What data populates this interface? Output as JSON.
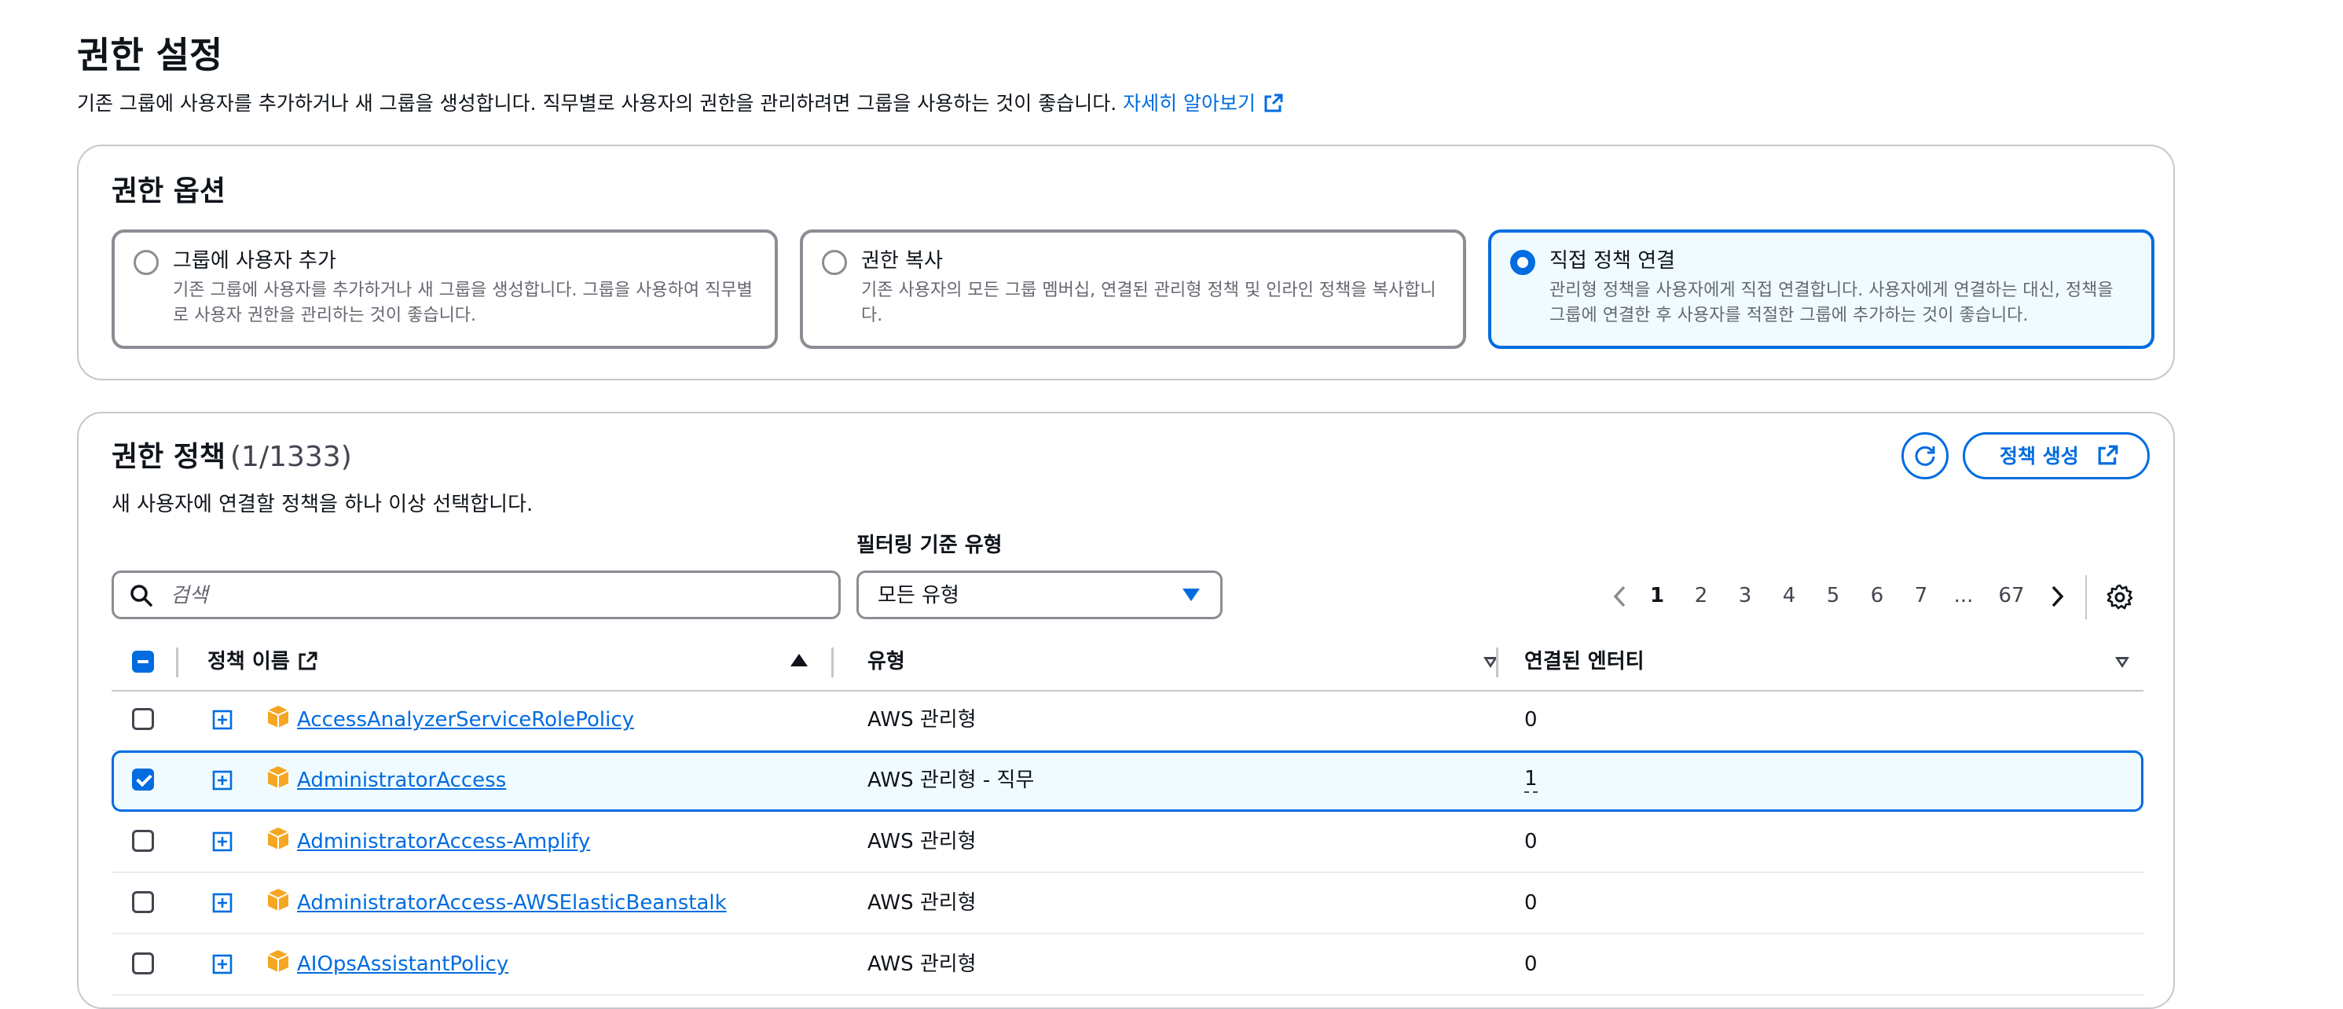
{
  "page": {
    "title": "권한 설정",
    "description": "기존 그룹에 사용자를 추가하거나 새 그룹을 생성합니다. 직무별로 사용자의 권한을 관리하려면 그룹을 사용하는 것이 좋습니다.",
    "learn_more": "자세히 알아보기"
  },
  "options": {
    "title": "권한 옵션",
    "tiles": [
      {
        "label": "그룹에 사용자 추가",
        "desc": "기존 그룹에 사용자를 추가하거나 새 그룹을 생성합니다. 그룹을 사용하여 직무별로 사용자 권한을 관리하는 것이 좋습니다.",
        "selected": false
      },
      {
        "label": "권한 복사",
        "desc": "기존 사용자의 모든 그룹 멤버십, 연결된 관리형 정책 및 인라인 정책을 복사합니다.",
        "selected": false
      },
      {
        "label": "직접 정책 연결",
        "desc": "관리형 정책을 사용자에게 직접 연결합니다. 사용자에게 연결하는 대신, 정책을 그룹에 연결한 후 사용자를 적절한 그룹에 추가하는 것이 좋습니다.",
        "selected": true
      }
    ]
  },
  "policies": {
    "title": "권한 정책",
    "count": "(1/1333)",
    "description": "새 사용자에 연결할 정책을 하나 이상 선택합니다.",
    "create_button": "정책 생성",
    "search": {
      "placeholder": "검색",
      "value": ""
    },
    "filter": {
      "label": "필터링 기준 유형",
      "value": "모든 유형"
    },
    "pagination": {
      "pages": [
        "1",
        "2",
        "3",
        "4",
        "5",
        "6",
        "7",
        "...",
        "67"
      ],
      "current": "1"
    },
    "columns": {
      "name": "정책 이름",
      "type": "유형",
      "entities": "연결된 엔터티"
    },
    "rows": [
      {
        "name": "AccessAnalyzerServiceRolePolicy",
        "type": "AWS 관리형",
        "entities": "0",
        "checked": false
      },
      {
        "name": "AdministratorAccess",
        "type": "AWS 관리형 - 직무",
        "entities": "1",
        "checked": true
      },
      {
        "name": "AdministratorAccess-Amplify",
        "type": "AWS 관리형",
        "entities": "0",
        "checked": false
      },
      {
        "name": "AdministratorAccess-AWSElasticBeanstalk",
        "type": "AWS 관리형",
        "entities": "0",
        "checked": false
      },
      {
        "name": "AIOpsAssistantPolicy",
        "type": "AWS 관리형",
        "entities": "0",
        "checked": false
      }
    ]
  },
  "colors": {
    "accent": "#006ce0",
    "border": "#8c8c94",
    "selected_bg": "#f0fbff",
    "package_icon": "#f5a623"
  },
  "icons": [
    "external-link-icon",
    "search-icon",
    "refresh-icon",
    "settings-gear-icon",
    "chevron-left-icon",
    "chevron-right-icon",
    "expand-plus-icon",
    "aws-package-icon",
    "caret-down-icon",
    "sort-ascending-icon",
    "sort-descending-icon"
  ]
}
